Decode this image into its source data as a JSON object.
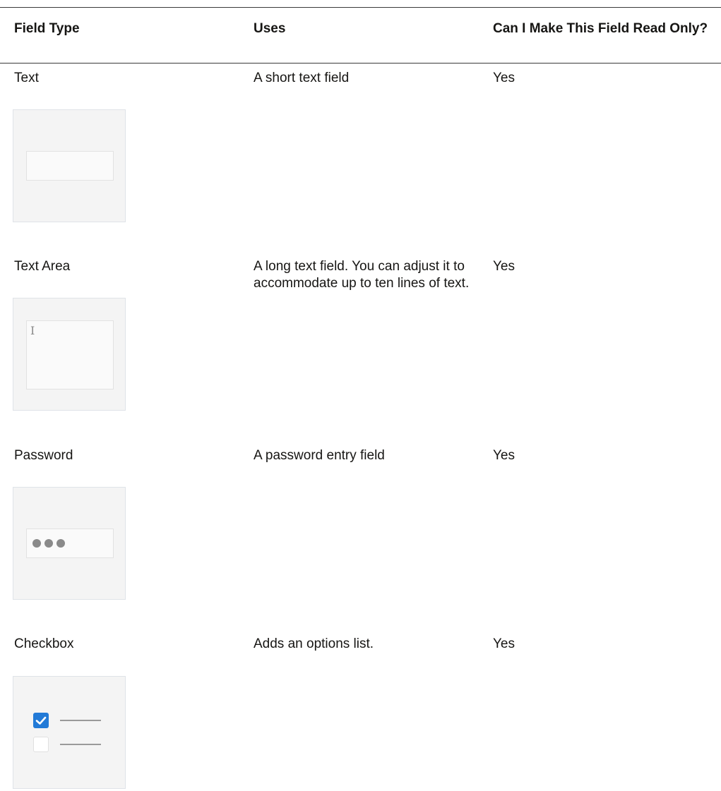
{
  "table": {
    "headers": {
      "field_type": "Field Type",
      "uses": "Uses",
      "read_only": "Can I Make This Field Read Only?"
    },
    "rows": [
      {
        "field_type": "Text",
        "uses": "A short text field",
        "read_only": "Yes",
        "icon": "text-field-icon"
      },
      {
        "field_type": "Text Area",
        "uses": "A long text field. You can adjust it to accommodate up to ten lines of text.",
        "read_only": "Yes",
        "icon": "text-area-icon",
        "cursor_glyph": "I"
      },
      {
        "field_type": "Password",
        "uses": "A password entry field",
        "read_only": "Yes",
        "icon": "password-field-icon"
      },
      {
        "field_type": "Checkbox",
        "uses": "Adds an options list.",
        "read_only": "Yes",
        "icon": "checkbox-list-icon",
        "checkbox_states": [
          true,
          false
        ]
      }
    ]
  },
  "colors": {
    "tile_bg": "#f4f4f4",
    "checkbox_checked": "#227ad7",
    "rule": "#3a3a3a"
  }
}
